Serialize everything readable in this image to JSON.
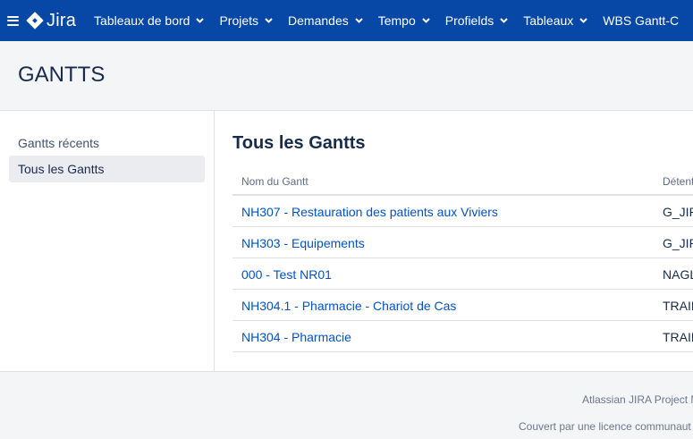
{
  "topnav": {
    "logo_text": "Jira",
    "items": [
      {
        "label": "Tableaux de bord"
      },
      {
        "label": "Projets"
      },
      {
        "label": "Demandes"
      },
      {
        "label": "Tempo"
      },
      {
        "label": "Profields"
      },
      {
        "label": "Tableaux"
      },
      {
        "label": "WBS Gantt-C"
      }
    ],
    "bg_color": "#0747a6"
  },
  "header": {
    "title": "GANTTS"
  },
  "sidebar": {
    "items": [
      {
        "label": "Gantts récents"
      },
      {
        "label": "Tous les Gantts",
        "selected": true
      }
    ]
  },
  "main": {
    "title": "Tous les Gantts",
    "columns": [
      "Nom du Gantt",
      "Détent"
    ],
    "rows": [
      {
        "name": "NH307 - Restauration des patients aux Viviers",
        "owner": "G_JIR"
      },
      {
        "name": "NH303 - Equipements",
        "owner": "G_JIR"
      },
      {
        "name": "000 - Test NR01",
        "owner": "NAGL"
      },
      {
        "name": "NH304.1 - Pharmacie - Chariot de Cas",
        "owner": "TRAIN"
      },
      {
        "name": "NH304 - Pharmacie",
        "owner": "TRAIN"
      }
    ],
    "link_color": "#0052cc"
  },
  "footer": {
    "line1": "Atlassian JIRA Project M",
    "line2": "Couvert par une licence communaut"
  }
}
